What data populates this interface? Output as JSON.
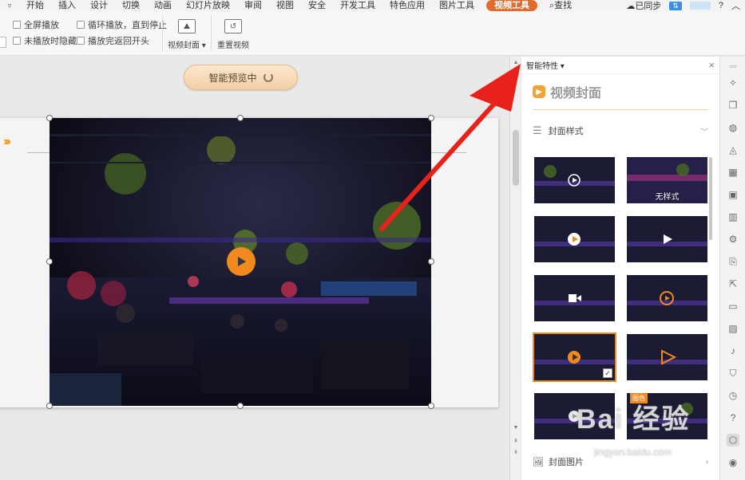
{
  "menu": {
    "items": [
      "开始",
      "插入",
      "设计",
      "切换",
      "动画",
      "幻灯片放映",
      "审阅",
      "视图",
      "安全",
      "开发工具",
      "特色应用",
      "图片工具"
    ],
    "active_tab": "视频工具",
    "search": "查找",
    "sync": "已同步",
    "help": "?"
  },
  "ribbon": {
    "fullscreen_play": "全屏播放",
    "loop_play": "循环播放，直到停止",
    "hide_when_not_playing": "未播放时隐藏",
    "rewind_after_play": "播放完返回开头",
    "video_cover": "视频封面",
    "reset_video": "重置视频"
  },
  "workspace": {
    "preview_button": "智能预览中"
  },
  "pane": {
    "header": "智能特性",
    "title": "视频封面",
    "section_label": "封面样式",
    "thumbnails": [
      {
        "label": "",
        "style": "circle-play"
      },
      {
        "label": "无样式",
        "style": "none"
      },
      {
        "label": "",
        "style": "orange-circle-play"
      },
      {
        "label": "",
        "style": "white-triangle"
      },
      {
        "label": "",
        "style": "camera"
      },
      {
        "label": "",
        "style": "orange-ring"
      },
      {
        "label": "",
        "style": "orange-speech-play",
        "checked": "✓"
      },
      {
        "label": "",
        "style": "outline-triangle"
      },
      {
        "label": "",
        "style": "circle-play-small"
      },
      {
        "label": "",
        "style": "tagged",
        "tag": "图色"
      }
    ],
    "bottom_label": "封面图片"
  },
  "watermark": {
    "main": "Bai 经验",
    "sub": "jingyan.baidu.com"
  },
  "colors": {
    "accent": "#f08a1e",
    "active_tab": "#e06b2f",
    "arrow": "#e8221b"
  }
}
